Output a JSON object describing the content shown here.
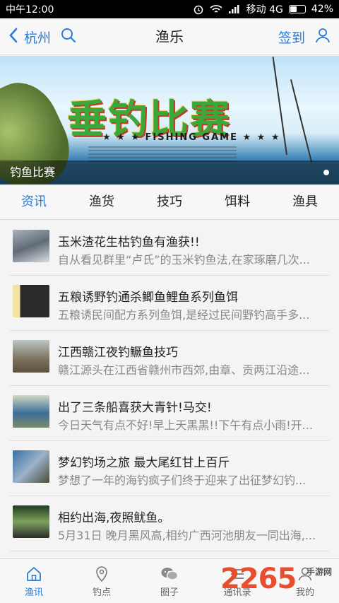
{
  "status_bar": {
    "time": "中午12:00",
    "carrier": "移动 4G",
    "battery": "42%"
  },
  "header": {
    "city": "杭州",
    "title": "渔乐",
    "signin": "签到"
  },
  "banner": {
    "title": "垂钓比赛",
    "subtitle": "★ ★ ★ FISHING GAME ★ ★ ★",
    "caption": "钓鱼比赛"
  },
  "tabs": [
    {
      "label": "资讯",
      "active": true
    },
    {
      "label": "渔货",
      "active": false
    },
    {
      "label": "技巧",
      "active": false
    },
    {
      "label": "饵料",
      "active": false
    },
    {
      "label": "渔具",
      "active": false
    }
  ],
  "news": [
    {
      "title": "玉米渣花生枯钓鱼有渔获!!",
      "desc": "自从看见群里“卢氏”的玉米钓鱼法,在家琢磨几次..."
    },
    {
      "title": "五粮诱野钓通杀鲫鱼鲤鱼系列鱼饵",
      "desc": "五粮诱民间配方系列鱼饵,是经过民间野钓高手多..."
    },
    {
      "title": "江西赣江夜钓鳜鱼技巧",
      "desc": "赣江源头在江西省赣州市西郊,由章、贡两江沿途..."
    },
    {
      "title": "出了三条船喜获大青针!马交!",
      "desc": "今日天气有点不好!早上天黑黑!!下午有点小雨!开..."
    },
    {
      "title": "梦幻钓场之旅 最大尾红甘上百斤",
      "desc": "梦想了一年的海钓疯子们终于迎来了出征梦幻钓..."
    },
    {
      "title": "相约出海,夜照鱿鱼。",
      "desc": "5月31日 晚月黑风高,相约广西河池朋友一同出海,..."
    }
  ],
  "bottom_nav": [
    {
      "label": "渔讯",
      "icon": "home-icon",
      "active": true
    },
    {
      "label": "钓点",
      "icon": "location-pin-icon",
      "active": false
    },
    {
      "label": "圈子",
      "icon": "chat-icon",
      "active": false
    },
    {
      "label": "通讯录",
      "icon": "contacts-icon",
      "active": false
    },
    {
      "label": "我的",
      "icon": "user-icon",
      "active": false
    }
  ],
  "watermark": {
    "number": "2265",
    "site": "手游网"
  },
  "colors": {
    "accent": "#2a7bd6",
    "text": "#222222",
    "muted": "#888888"
  }
}
